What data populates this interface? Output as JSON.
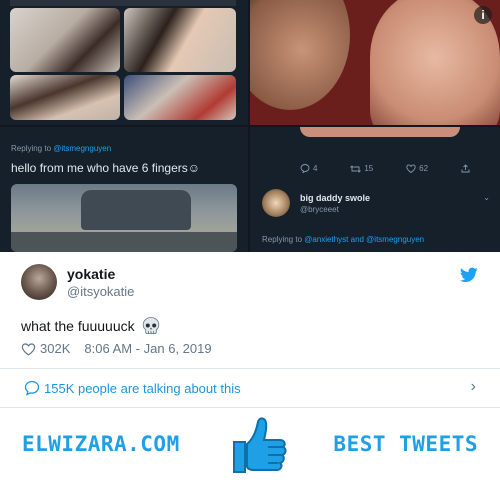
{
  "collage": {
    "panel_bl": {
      "replying_prefix": "Replying to ",
      "replying_mention": "@itsmegnguyen",
      "text": "hello from me who have 6 fingers",
      "emoji": "☺"
    },
    "panel_br": {
      "actions": {
        "replies": "4",
        "retweets": "15",
        "likes": "62"
      },
      "display_name": "big daddy swole",
      "handle": "@bryceeet",
      "replying_prefix": "Replying to ",
      "replying_mentions": "@anxiethyst and @itsmegnguyen"
    },
    "info_icon": "info-icon"
  },
  "tweet": {
    "display_name": "yokatie",
    "handle": "@itsyokatie",
    "text": "what the fuuuuuck",
    "emoji_icon": "skull-icon",
    "likes": "302K",
    "timestamp": "8:06 AM - Jan 6, 2019",
    "talking": "155K people are talking about this"
  },
  "banner": {
    "left_text": "ELWIZARA.COM",
    "right_text": "BEST TWEETS",
    "icon": "thumbs-up-icon",
    "accent": "#1f9fe6"
  },
  "colors": {
    "twitter_blue": "#1da1f2",
    "link_blue": "#1b95e0",
    "muted": "#657786",
    "dark_bg": "#15202b"
  }
}
